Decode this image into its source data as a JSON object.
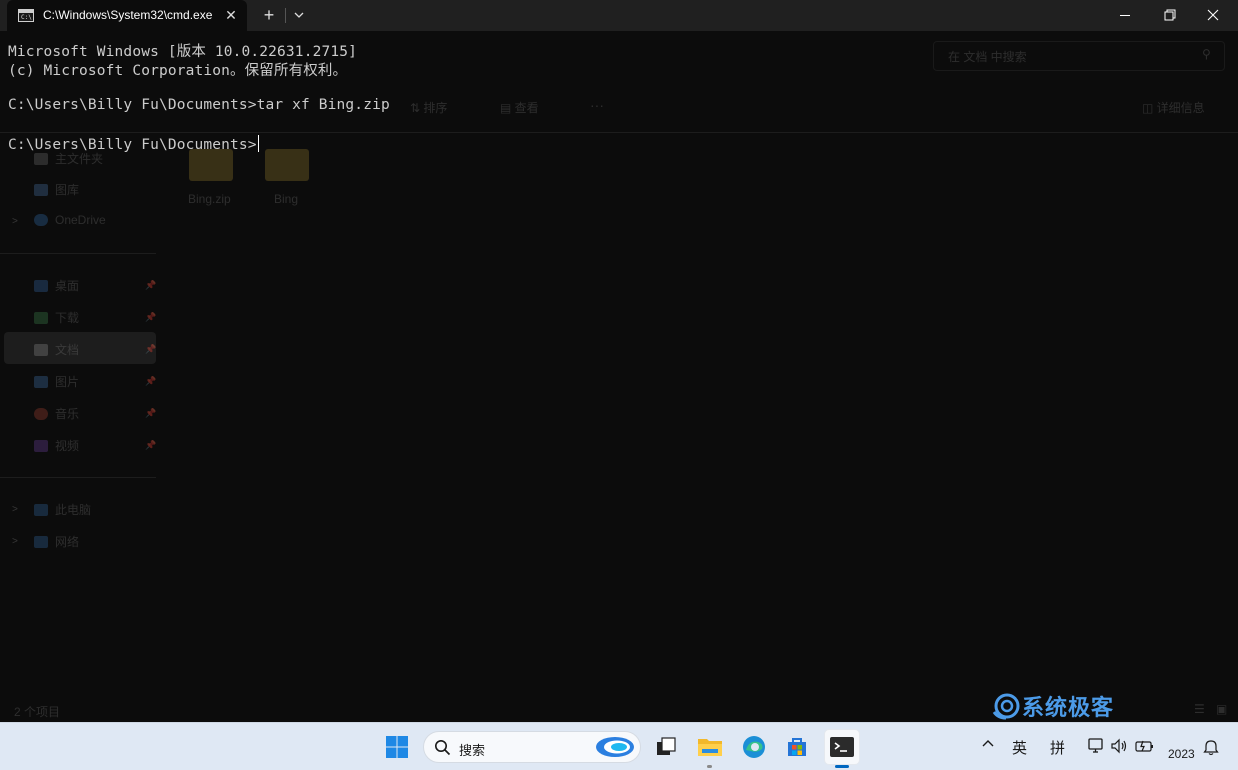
{
  "window": {
    "tab_title": "C:\\Windows\\System32\\cmd.exe",
    "tab_icon_text": "C:\\",
    "close_tab_symbol": "✕",
    "new_tab_symbol": "+"
  },
  "console": {
    "lines": [
      "Microsoft Windows [版本 10.0.22631.2715]",
      "(c) Microsoft Corporation。保留所有权利。",
      "",
      "C:\\Users\\Billy Fu\\Documents>tar xf Bing.zip",
      "",
      "C:\\Users\\Billy Fu\\Documents>"
    ]
  },
  "background_explorer": {
    "search_placeholder": "在 文档 中搜索",
    "toolbar": {
      "sort": "排序",
      "view": "查看",
      "more": "···",
      "details": "详细信息"
    },
    "sidebar": [
      "主文件夹",
      "图库",
      "OneDrive",
      "桌面",
      "下载",
      "文档",
      "图片",
      "音乐",
      "视频",
      "此电脑",
      "网络"
    ],
    "files": [
      "Bing.zip",
      "Bing"
    ],
    "status": "2 个项目"
  },
  "watermark": {
    "text": "系统极客"
  },
  "taskbar": {
    "search_label": "搜索",
    "ime_lang": "英",
    "ime_mode": "拼",
    "clock": "2023",
    "icons": [
      "windows-start-icon",
      "search-icon",
      "copilot-icon",
      "task-view-icon",
      "file-explorer-icon",
      "edge-icon",
      "store-icon",
      "terminal-icon"
    ]
  },
  "colors": {
    "console_bg": "#0c0c0c",
    "console_text": "#cccccc",
    "taskbar_bg": "#dfe8f4",
    "accent": "#0067c0",
    "watermark": "#4c9be8"
  }
}
